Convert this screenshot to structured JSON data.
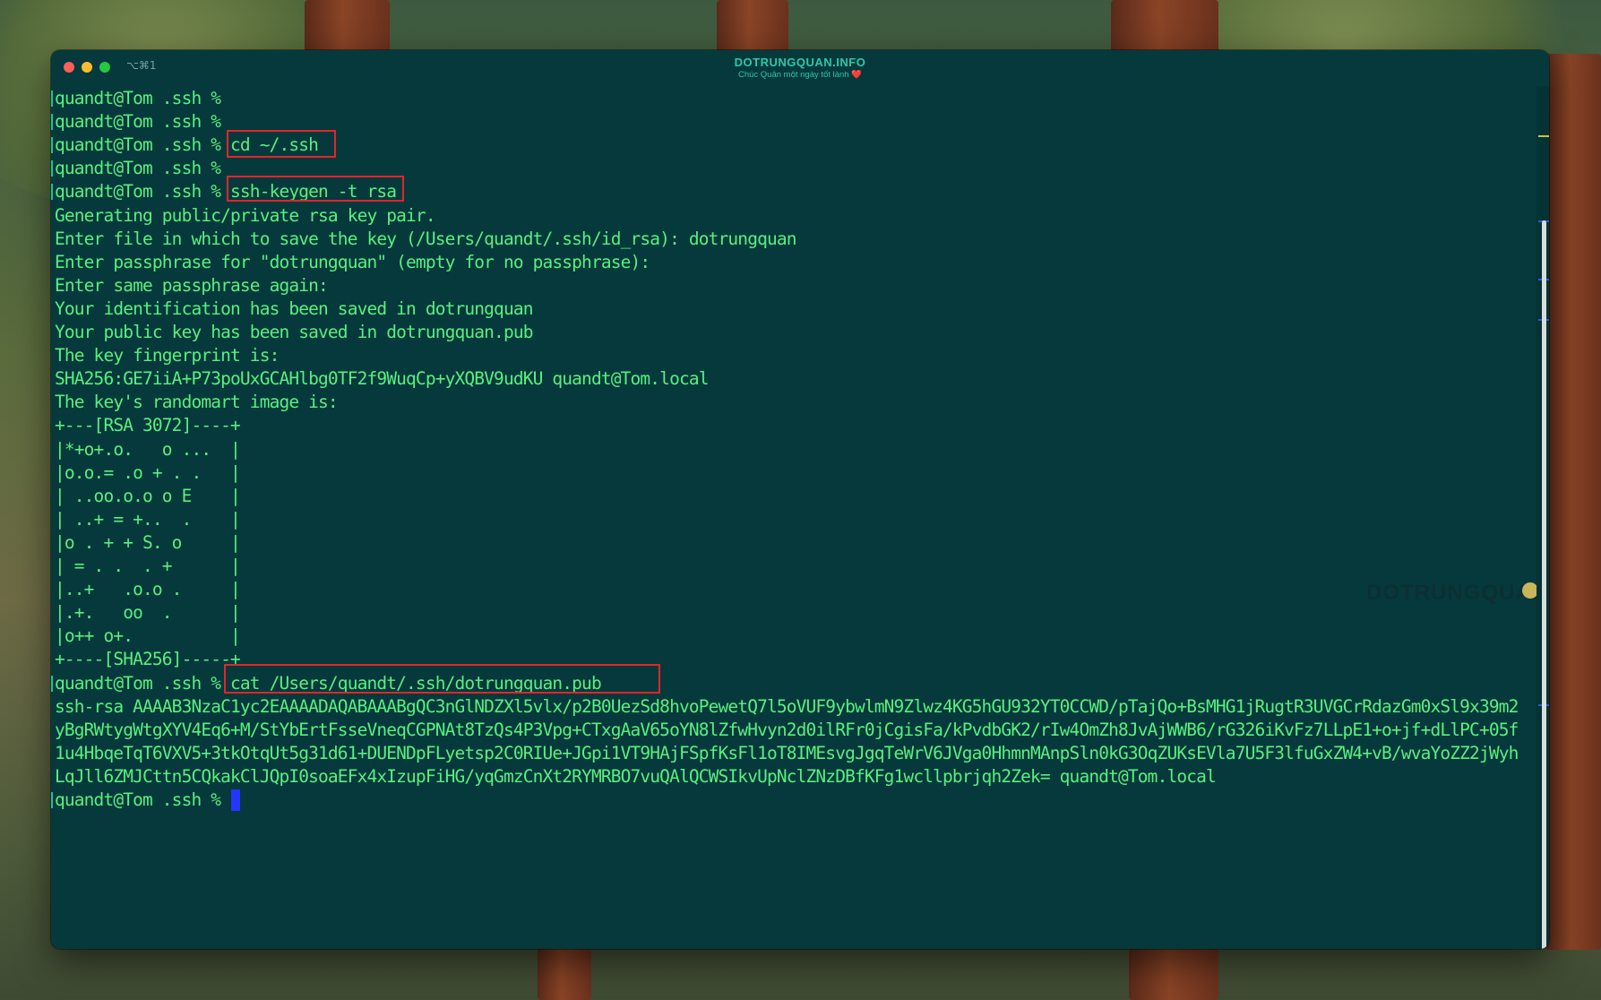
{
  "window": {
    "shortcut": "⌥⌘1",
    "title": "DOTRUNGQUAN.INFO",
    "subtitle": "Chúc Quân một ngày tốt lành ❤️"
  },
  "terminal": {
    "lines": [
      "quandt@Tom .ssh %",
      "quandt@Tom .ssh %",
      "quandt@Tom .ssh % cd ~/.ssh",
      "quandt@Tom .ssh %",
      "quandt@Tom .ssh % ssh-keygen -t rsa",
      "Generating public/private rsa key pair.",
      "Enter file in which to save the key (/Users/quandt/.ssh/id_rsa): dotrungquan",
      "Enter passphrase for \"dotrungquan\" (empty for no passphrase):",
      "Enter same passphrase again:",
      "Your identification has been saved in dotrungquan",
      "Your public key has been saved in dotrungquan.pub",
      "The key fingerprint is:",
      "SHA256:GE7iiA+P73poUxGCAHlbg0TF2f9WuqCp+yXQBV9udKU quandt@Tom.local",
      "The key's randomart image is:",
      "+---[RSA 3072]----+",
      "|*+o+.o.   o ...  |",
      "|o.o.= .o + . .   |",
      "| ..oo.o.o o E    |",
      "| ..+ = +..  .    |",
      "|o . + + S. o     |",
      "| = . .  . +      |",
      "|..+   .o.o .     |",
      "|.+.   oo  .      |",
      "|o++ o+.          |",
      "+----[SHA256]-----+",
      "quandt@Tom .ssh % cat /Users/quandt/.ssh/dotrungquan.pub",
      "ssh-rsa AAAAB3NzaC1yc2EAAAADAQABAAABgQC3nGlNDZXl5vlx/p2B0UezSd8hvoPewetQ7l5oVUF9ybwlmN9Zlwz4KG5hGU932YT0CCWD/pTajQo+BsMHG1jRugtR3UVGCrRdazGm0xSl9x39m2",
      "yBgRWtygWtgXYV4Eq6+M/StYbErtFsseVneqCGPNAt8TzQs4P3Vpg+CTxgAaV65oYN8lZfwHvyn2d0ilRFr0jCgisFa/kPvdbGK2/rIw4OmZh8JvAjWWB6/rG326iKvFz7LLpE1+o+jf+dLlPC+05f",
      "1u4HbqeTqT6VXV5+3tkOtqUt5g31d61+DUENDpFLyetsp2C0RIUe+JGpi1VT9HAjFSpfKsFl1oT8IMEsvgJgqTeWrV6JVga0HhmnMAnpSln0kG3OqZUKsEVla7U5F3lfuGxZW4+vB/wvaYoZZ2jWyh",
      "LqJll6ZMJCttn5CQkakClJQpI0soaEFx4xIzupFiHG/yqGmzCnXt2RYMRBO7vuQAlQCWSIkvUpNclZNzDBfKFg1wcllpbrjqh2Zek= quandt@Tom.local",
      "quandt@Tom .ssh %"
    ]
  },
  "watermark": "DOTRUNGQUAN",
  "colors": {
    "background": "#05393c",
    "text": "#59f07e",
    "highlight": "#e0262a",
    "cursor": "#2436ff"
  }
}
